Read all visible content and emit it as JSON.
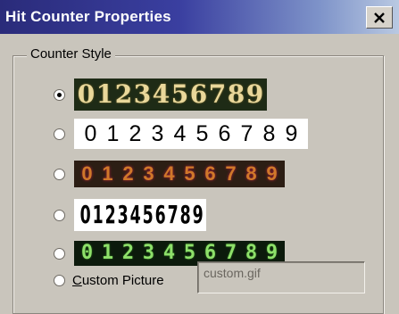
{
  "window": {
    "title": "Hit Counter Properties"
  },
  "group": {
    "legend": "Counter Style"
  },
  "options": [
    {
      "digits": [
        "0",
        "1",
        "2",
        "3",
        "4",
        "5",
        "6",
        "7",
        "8",
        "9"
      ],
      "selected": true
    },
    {
      "digits": [
        "0",
        "1",
        "2",
        "3",
        "4",
        "5",
        "6",
        "7",
        "8",
        "9"
      ],
      "selected": false
    },
    {
      "digits": [
        "0",
        "1",
        "2",
        "3",
        "4",
        "5",
        "6",
        "7",
        "8",
        "9"
      ],
      "selected": false
    },
    {
      "digits": [
        "0",
        "1",
        "2",
        "3",
        "4",
        "5",
        "6",
        "7",
        "8",
        "9"
      ],
      "selected": false
    },
    {
      "digits": [
        "0",
        "1",
        "2",
        "3",
        "4",
        "5",
        "6",
        "7",
        "8",
        "9"
      ],
      "selected": false
    }
  ],
  "custom": {
    "label_prefix": "C",
    "label_rest": "ustom Picture",
    "selected": false,
    "value": "custom.gif"
  },
  "icons": {
    "close": "close-icon"
  }
}
